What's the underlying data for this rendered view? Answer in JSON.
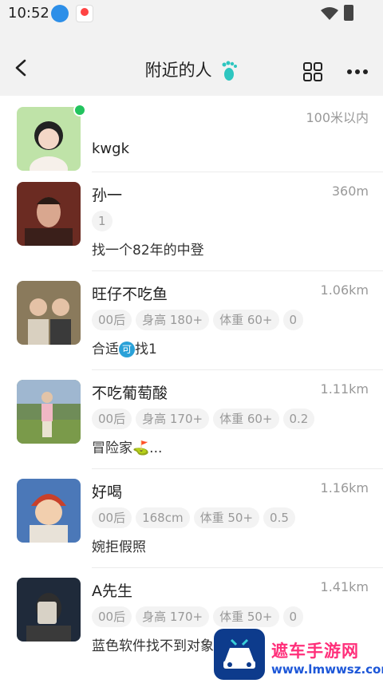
{
  "status_bar": {
    "time": "10:52"
  },
  "header": {
    "title": "附近的人",
    "back_icon": "back-arrow-icon",
    "footprint_icon": "footprint-icon",
    "grid_icon": "grid-icon",
    "more_icon": "more-dots-icon"
  },
  "users": [
    {
      "name": "kwgk",
      "distance": "100米以内",
      "tags": [],
      "bio": "",
      "online": true
    },
    {
      "name": "孙一",
      "distance": "360m",
      "tags": [
        "1"
      ],
      "bio": "找一个82年的中登"
    },
    {
      "name": "旺仔不吃鱼",
      "distance": "1.06km",
      "tags": [
        "00后",
        "身高 180+",
        "体重 60+",
        "0"
      ],
      "bio_before": "合适",
      "bio_badge": "可",
      "bio_after": "找1"
    },
    {
      "name": "不吃葡萄酸",
      "distance": "1.11km",
      "tags": [
        "00后",
        "身高 170+",
        "体重 60+",
        "0.2"
      ],
      "bio": "冒险家⛳..."
    },
    {
      "name": "好喝",
      "distance": "1.16km",
      "tags": [
        "00后",
        "168cm",
        "体重 50+",
        "0.5"
      ],
      "bio": "婉拒假照"
    },
    {
      "name": "A先生",
      "distance": "1.41km",
      "tags": [
        "00后",
        "身高 170+",
        "体重 50+",
        "0"
      ],
      "bio": "蓝色软件找不到对象"
    }
  ],
  "watermark": {
    "text": "遮车手游网",
    "url": "www.lmwwsz.com"
  },
  "colors": {
    "online": "#22c35e",
    "badge": "#2aa1d8",
    "tag_bg": "#f3f3f3"
  }
}
